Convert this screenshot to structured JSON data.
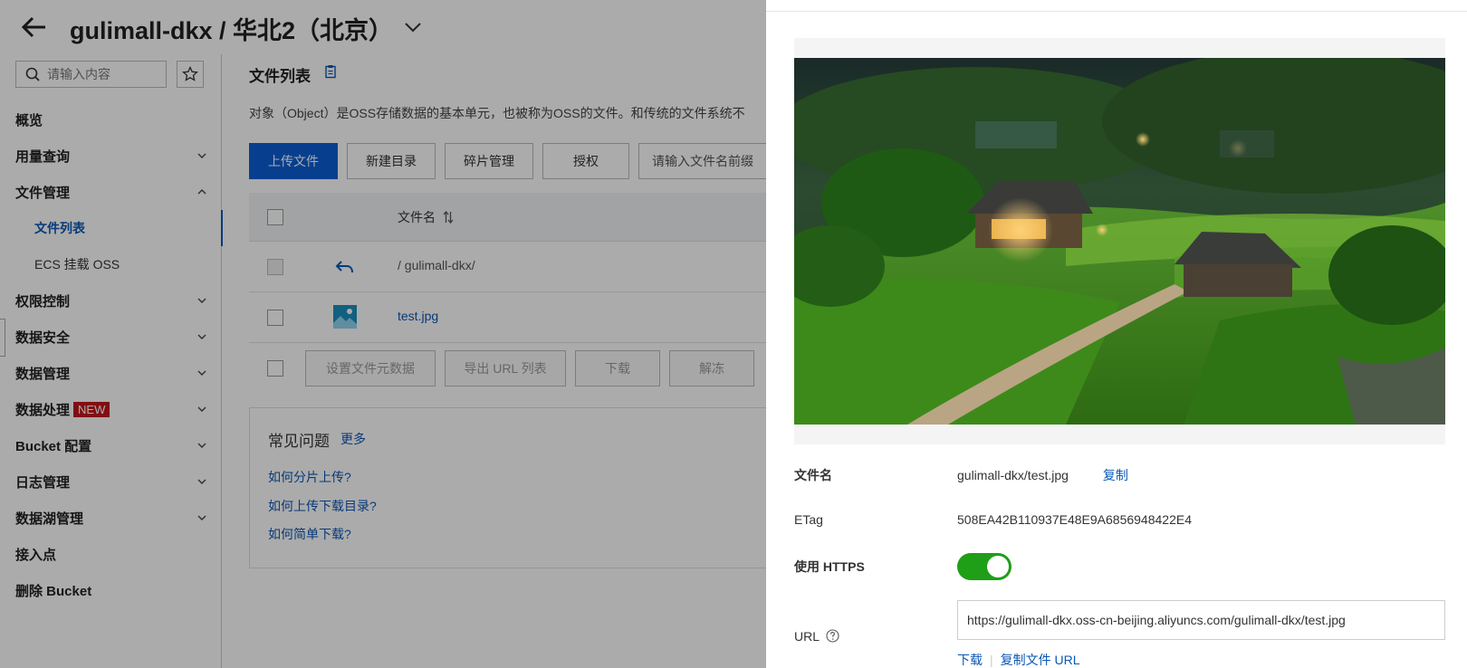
{
  "header": {
    "title": "gulimall-dkx / 华北2（北京）"
  },
  "sidebar": {
    "search_placeholder": "请输入内容",
    "items": [
      {
        "label": "概览"
      },
      {
        "label": "用量查询"
      },
      {
        "label": "文件管理"
      },
      {
        "label": "文件列表"
      },
      {
        "label": "ECS 挂载 OSS"
      },
      {
        "label": "权限控制"
      },
      {
        "label": "数据安全"
      },
      {
        "label": "数据管理"
      },
      {
        "label": "数据处理",
        "badge": "NEW"
      },
      {
        "label": "Bucket 配置"
      },
      {
        "label": "日志管理"
      },
      {
        "label": "数据湖管理"
      },
      {
        "label": "接入点"
      },
      {
        "label": "删除 Bucket"
      }
    ]
  },
  "main": {
    "title": "文件列表",
    "description": "对象（Object）是OSS存储数据的基本单元，也被称为OSS的文件。和传统的文件系统不",
    "buttons": {
      "upload": "上传文件",
      "new_dir": "新建目录",
      "fragments": "碎片管理",
      "authorize": "授权"
    },
    "filter_placeholder": "请输入文件名前缀",
    "table": {
      "header_name": "文件名",
      "rows": [
        {
          "name": "/ gulimall-dkx/"
        },
        {
          "name": "test.jpg"
        }
      ],
      "footer_buttons": {
        "set_meta": "设置文件元数据",
        "export_url": "导出 URL 列表",
        "download": "下载",
        "unfreeze": "解冻"
      }
    },
    "faq": {
      "title": "常见问题",
      "more": "更多",
      "links": [
        "如何分片上传?",
        "如何上传下载目录?",
        "如何简单下载?"
      ]
    }
  },
  "drawer": {
    "file_name_label": "文件名",
    "file_name_value": "gulimall-dkx/test.jpg",
    "copy_label": "复制",
    "etag_label": "ETag",
    "etag_value": "508EA42B110937E48E9A6856948422E4",
    "https_label": "使用 HTTPS",
    "https_enabled": true,
    "url_label": "URL",
    "url_value": "https://gulimall-dkx.oss-cn-beijing.aliyuncs.com/gulimall-dkx/test.jpg",
    "download_label": "下载",
    "copy_url_label": "复制文件 URL"
  },
  "colors": {
    "primary": "#0b5fd4",
    "link": "#0b57b5",
    "toggle_on": "#1f9e18",
    "badge": "#c0171b"
  }
}
